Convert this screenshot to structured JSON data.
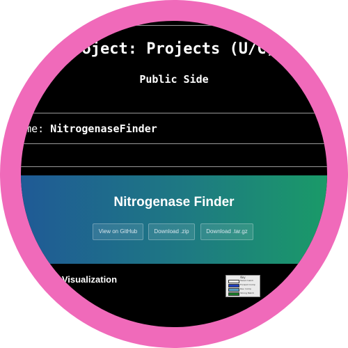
{
  "page": {
    "title": "roject: Projects (U/C)",
    "subtitle": "Public Side",
    "project_name_label": "t Name:",
    "project_name_value": "NitrogenaseFinder"
  },
  "banner": {
    "title": "Nitrogenase Finder",
    "buttons": [
      {
        "label": "View on GitHub"
      },
      {
        "label": "Download .zip"
      },
      {
        "label": "Download .tar.gz"
      }
    ]
  },
  "section": {
    "visualization_title": "e Visualization"
  },
  "key": {
    "title": "Key",
    "entries": [
      {
        "label": "Failed match",
        "color": "#ffffff"
      },
      {
        "label": "Forward Comp",
        "color": "#1f3fbf"
      },
      {
        "label": "Rev. Comp",
        "color": "#5aa0c8"
      },
      {
        "label": "Strong Match",
        "color": "#1a7a2a"
      }
    ]
  },
  "colors": {
    "frame_ring": "#f06aba",
    "page_background": "#000000",
    "banner_gradient_start": "#1f5a96",
    "banner_gradient_end": "#1a9a68"
  }
}
